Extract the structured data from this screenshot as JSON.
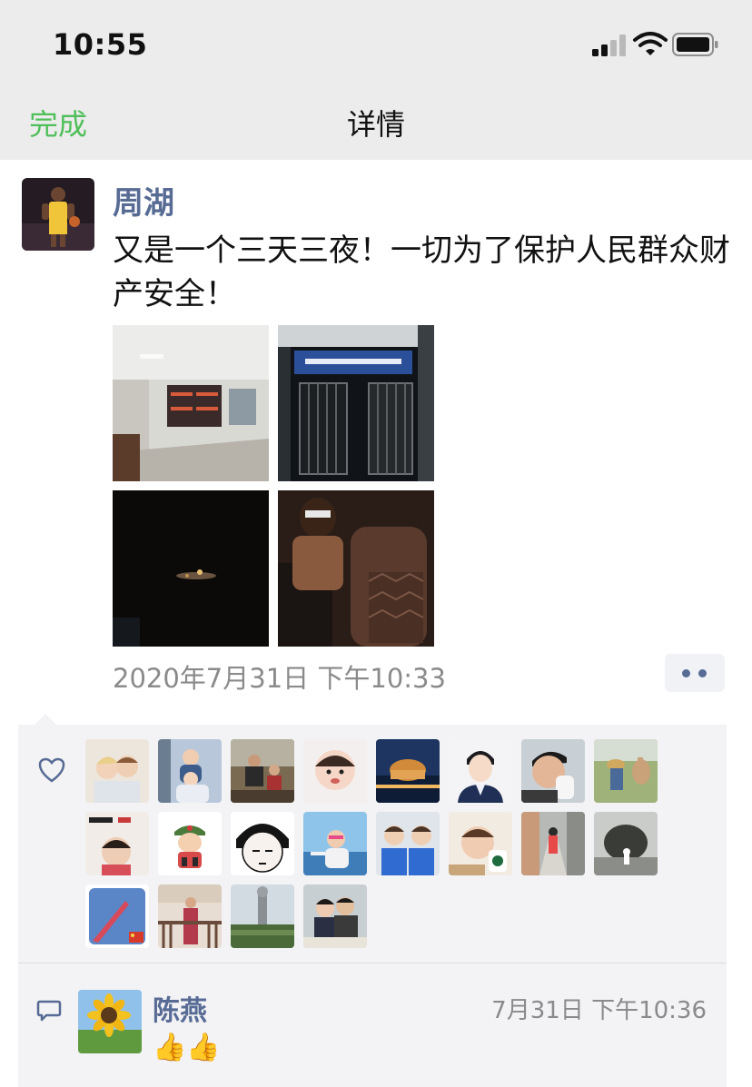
{
  "status_bar": {
    "time": "10:55",
    "signal_icon": "cellular-signal-icon",
    "wifi_icon": "wifi-icon",
    "battery_icon": "battery-icon"
  },
  "nav": {
    "done_label": "完成",
    "title": "详情"
  },
  "post": {
    "author": "周湖",
    "text": "又是一个三天三夜！一切为了保护人民群众财产安全！",
    "timestamp": "2020年7月31日 下午10:33",
    "more_icon": "more-dots-icon"
  },
  "likes": {
    "heart_icon": "heart-icon",
    "count": 19
  },
  "comment": {
    "comment_icon": "comment-bubble-icon",
    "name": "陈燕",
    "time": "7月31日 下午10:36",
    "text": "👍👍"
  },
  "colors": {
    "accent_green": "#4fbf5a",
    "link_blue": "#576b95",
    "gray_text": "#8a8a8a",
    "panel_bg": "#f3f3f5",
    "bar_bg": "#ececec"
  }
}
